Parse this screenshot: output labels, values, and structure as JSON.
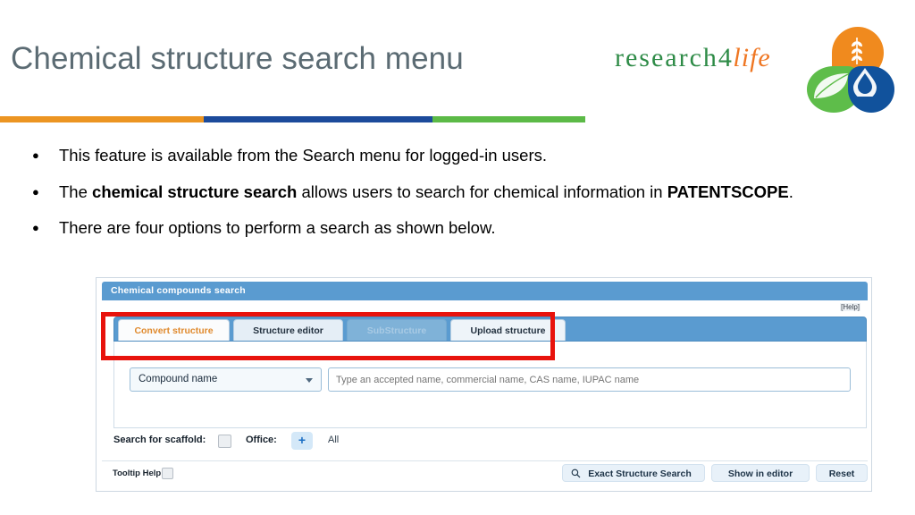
{
  "slide": {
    "title": "Chemical structure search menu",
    "bullets": [
      {
        "parts": [
          {
            "text": "This feature is available from the Search menu for logged-in users.",
            "bold": false
          }
        ]
      },
      {
        "parts": [
          {
            "text": "The ",
            "bold": false
          },
          {
            "text": "chemical structure search",
            "bold": true
          },
          {
            "text": " allows users to search for chemical information in ",
            "bold": false
          },
          {
            "text": "PATENTSCOPE",
            "bold": true
          },
          {
            "text": ".",
            "bold": false
          }
        ]
      },
      {
        "parts": [
          {
            "text": "There are four options to perform a search as shown below.",
            "bold": false
          }
        ]
      }
    ]
  },
  "logo": {
    "research": "research",
    "four": "4",
    "life": "life",
    "colors": {
      "green": "#2e8b47",
      "orange": "#ef7622",
      "petal_orange": "#f08a1e",
      "petal_green": "#5ebd4a",
      "petal_blue": "#11529c"
    }
  },
  "rule": {
    "orange": "#ec9522",
    "blue": "#1c4b9b",
    "green": "#5cba47"
  },
  "screenshot": {
    "title": "Chemical compounds search",
    "help_link": "[Help]",
    "tabs": [
      {
        "label": "Convert structure",
        "state": "active"
      },
      {
        "label": "Structure editor",
        "state": "normal"
      },
      {
        "label": "SubStructure",
        "state": "disabled"
      },
      {
        "label": "Upload structure",
        "state": "normal"
      }
    ],
    "highlight_color": "#e8130d",
    "field": {
      "select_value": "Compound name",
      "input_placeholder": "Type an accepted name, commercial name, CAS name, IUPAC name",
      "input_value": ""
    },
    "scaffold": {
      "label": "Search for scaffold:",
      "checked": false,
      "office_label": "Office:",
      "office_add": "+",
      "office_value": "All"
    },
    "footer": {
      "tooltip_help": "Tooltip Help",
      "tooltip_checked": false,
      "buttons": [
        {
          "label": "Exact Structure Search",
          "icon": "search-icon"
        },
        {
          "label": "Show in editor",
          "icon": ""
        },
        {
          "label": "Reset",
          "icon": ""
        }
      ]
    }
  }
}
